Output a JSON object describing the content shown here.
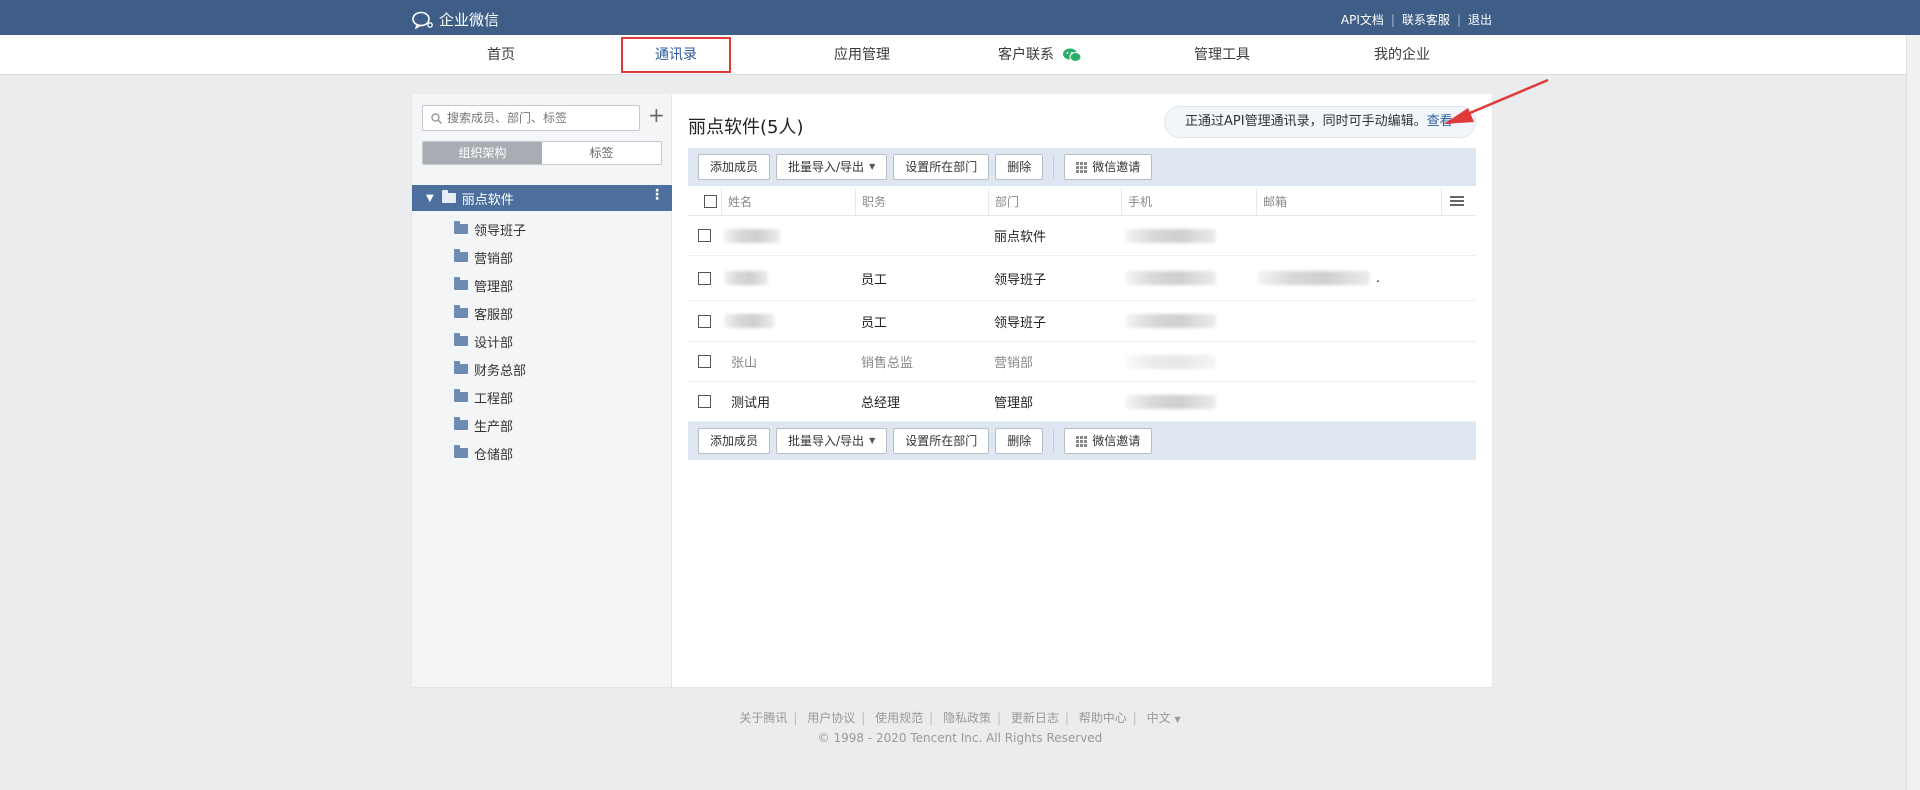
{
  "app": {
    "logo_text": "企业微信"
  },
  "top_links": {
    "api_docs": "API文档",
    "support": "联系客服",
    "logout": "退出"
  },
  "nav": {
    "home": "首页",
    "contacts": "通讯录",
    "apps": "应用管理",
    "customers": "客户联系",
    "tools": "管理工具",
    "company": "我的企业"
  },
  "sidebar": {
    "search_placeholder": "搜索成员、部门、标签",
    "seg_org": "组织架构",
    "seg_tags": "标签",
    "root": "丽点软件",
    "departments": [
      "领导班子",
      "营销部",
      "管理部",
      "客服部",
      "设计部",
      "财务总部",
      "工程部",
      "生产部",
      "仓储部"
    ]
  },
  "content": {
    "title": "丽点软件(5人)",
    "notice_text": "正通过API管理通讯录，同时可手动编辑。",
    "notice_link": "查看",
    "toolbar": {
      "add_member": "添加成员",
      "batch": "批量导入/导出",
      "set_dept": "设置所在部门",
      "delete": "删除",
      "wechat_invite": "微信邀请"
    },
    "columns": {
      "name": "姓名",
      "title": "职务",
      "dept": "部门",
      "phone": "手机",
      "email": "邮箱"
    },
    "rows": [
      {
        "name": "",
        "title": "",
        "dept": "丽点软件"
      },
      {
        "name": "",
        "title": "员工",
        "dept": "领导班子",
        "email_suffix": "."
      },
      {
        "name": "",
        "title": "员工",
        "dept": "领导班子"
      },
      {
        "name": "张山",
        "title": "销售总监",
        "dept": "营销部"
      },
      {
        "name": "测试用",
        "title": "总经理",
        "dept": "管理部"
      }
    ]
  },
  "footer": {
    "links": [
      "关于腾讯",
      "用户协议",
      "使用规范",
      "隐私政策",
      "更新日志",
      "帮助中心"
    ],
    "language": "中文",
    "copyright": "© 1998 - 2020 Tencent Inc. All Rights Reserved"
  },
  "colors": {
    "topbar": "#3e5e88",
    "accent": "#2b5f9e",
    "highlight_box": "#e23a3a",
    "arrow": "#e03a3a"
  }
}
